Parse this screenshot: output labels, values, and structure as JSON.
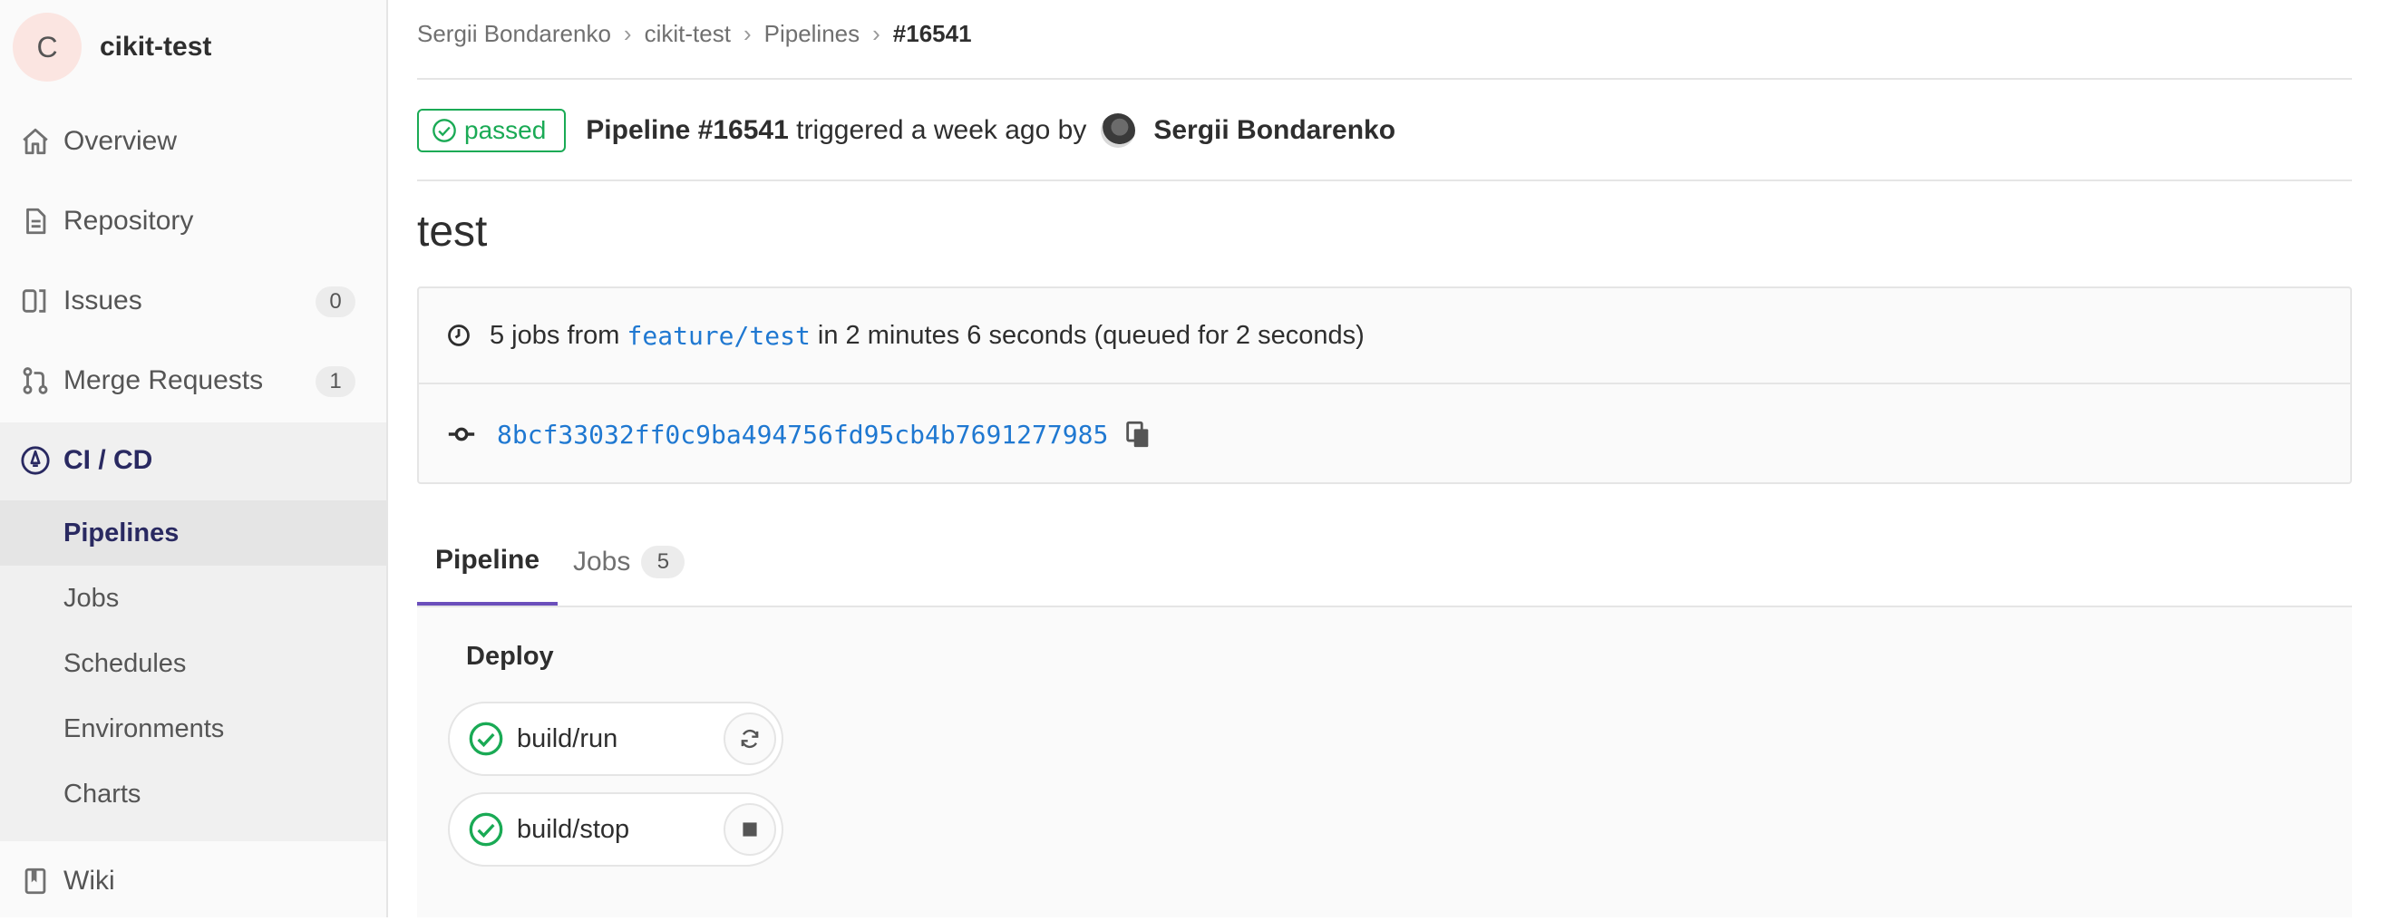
{
  "project": {
    "initial": "C",
    "name": "cikit-test"
  },
  "nav": {
    "overview": "Overview",
    "repository": "Repository",
    "issues": {
      "label": "Issues",
      "count": "0"
    },
    "merge_requests": {
      "label": "Merge Requests",
      "count": "1"
    },
    "cicd": "CI / CD",
    "sub": {
      "pipelines": "Pipelines",
      "jobs": "Jobs",
      "schedules": "Schedules",
      "environments": "Environments",
      "charts": "Charts"
    },
    "wiki": "Wiki"
  },
  "breadcrumb": [
    "Sergii Bondarenko",
    "cikit-test",
    "Pipelines",
    "#16541"
  ],
  "pipeline": {
    "status": "passed",
    "name": "Pipeline #16541",
    "triggered": "triggered a week ago by",
    "user": "Sergii Bondarenko",
    "title": "test",
    "jobs_prefix": "5 jobs from",
    "branch": "feature/test",
    "duration": "in 2 minutes 6 seconds (queued for 2 seconds)",
    "commit_sha": "8bcf33032ff0c9ba494756fd95cb4b7691277985"
  },
  "tabs": {
    "pipeline": "Pipeline",
    "jobs": "Jobs",
    "jobs_count": "5"
  },
  "stage": {
    "name": "Deploy",
    "jobs": [
      {
        "name": "build/run",
        "action": "retry-icon"
      },
      {
        "name": "build/stop",
        "action": "stop-icon"
      }
    ]
  },
  "colors": {
    "success": "#1aaa55",
    "link": "#1f78d1",
    "active_tab": "#6b4fbb",
    "nav_active": "#292961"
  }
}
